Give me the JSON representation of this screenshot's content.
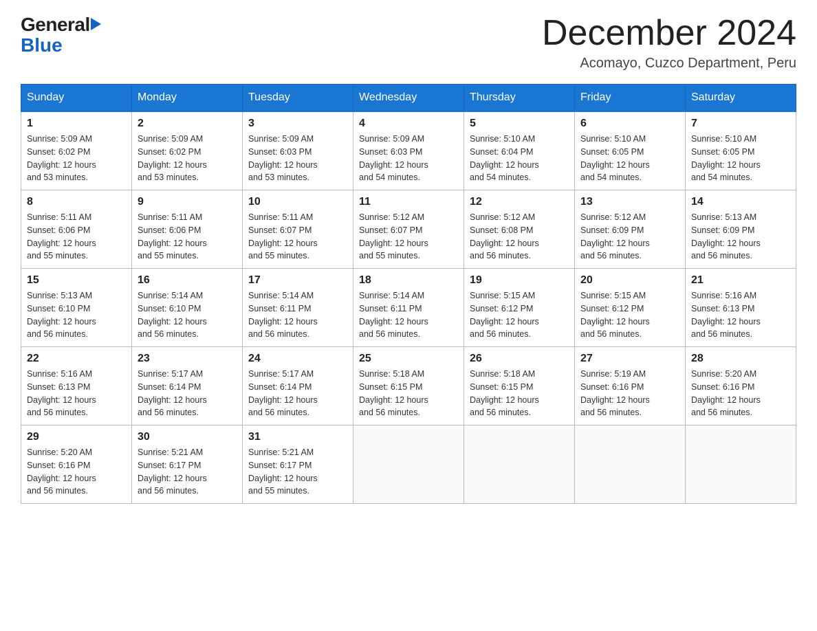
{
  "header": {
    "logo_general": "General",
    "logo_blue": "Blue",
    "title": "December 2024",
    "location": "Acomayo, Cuzco Department, Peru"
  },
  "days_of_week": [
    "Sunday",
    "Monday",
    "Tuesday",
    "Wednesday",
    "Thursday",
    "Friday",
    "Saturday"
  ],
  "weeks": [
    [
      {
        "day": "1",
        "sunrise": "5:09 AM",
        "sunset": "6:02 PM",
        "daylight": "12 hours and 53 minutes."
      },
      {
        "day": "2",
        "sunrise": "5:09 AM",
        "sunset": "6:02 PM",
        "daylight": "12 hours and 53 minutes."
      },
      {
        "day": "3",
        "sunrise": "5:09 AM",
        "sunset": "6:03 PM",
        "daylight": "12 hours and 53 minutes."
      },
      {
        "day": "4",
        "sunrise": "5:09 AM",
        "sunset": "6:03 PM",
        "daylight": "12 hours and 54 minutes."
      },
      {
        "day": "5",
        "sunrise": "5:10 AM",
        "sunset": "6:04 PM",
        "daylight": "12 hours and 54 minutes."
      },
      {
        "day": "6",
        "sunrise": "5:10 AM",
        "sunset": "6:05 PM",
        "daylight": "12 hours and 54 minutes."
      },
      {
        "day": "7",
        "sunrise": "5:10 AM",
        "sunset": "6:05 PM",
        "daylight": "12 hours and 54 minutes."
      }
    ],
    [
      {
        "day": "8",
        "sunrise": "5:11 AM",
        "sunset": "6:06 PM",
        "daylight": "12 hours and 55 minutes."
      },
      {
        "day": "9",
        "sunrise": "5:11 AM",
        "sunset": "6:06 PM",
        "daylight": "12 hours and 55 minutes."
      },
      {
        "day": "10",
        "sunrise": "5:11 AM",
        "sunset": "6:07 PM",
        "daylight": "12 hours and 55 minutes."
      },
      {
        "day": "11",
        "sunrise": "5:12 AM",
        "sunset": "6:07 PM",
        "daylight": "12 hours and 55 minutes."
      },
      {
        "day": "12",
        "sunrise": "5:12 AM",
        "sunset": "6:08 PM",
        "daylight": "12 hours and 56 minutes."
      },
      {
        "day": "13",
        "sunrise": "5:12 AM",
        "sunset": "6:09 PM",
        "daylight": "12 hours and 56 minutes."
      },
      {
        "day": "14",
        "sunrise": "5:13 AM",
        "sunset": "6:09 PM",
        "daylight": "12 hours and 56 minutes."
      }
    ],
    [
      {
        "day": "15",
        "sunrise": "5:13 AM",
        "sunset": "6:10 PM",
        "daylight": "12 hours and 56 minutes."
      },
      {
        "day": "16",
        "sunrise": "5:14 AM",
        "sunset": "6:10 PM",
        "daylight": "12 hours and 56 minutes."
      },
      {
        "day": "17",
        "sunrise": "5:14 AM",
        "sunset": "6:11 PM",
        "daylight": "12 hours and 56 minutes."
      },
      {
        "day": "18",
        "sunrise": "5:14 AM",
        "sunset": "6:11 PM",
        "daylight": "12 hours and 56 minutes."
      },
      {
        "day": "19",
        "sunrise": "5:15 AM",
        "sunset": "6:12 PM",
        "daylight": "12 hours and 56 minutes."
      },
      {
        "day": "20",
        "sunrise": "5:15 AM",
        "sunset": "6:12 PM",
        "daylight": "12 hours and 56 minutes."
      },
      {
        "day": "21",
        "sunrise": "5:16 AM",
        "sunset": "6:13 PM",
        "daylight": "12 hours and 56 minutes."
      }
    ],
    [
      {
        "day": "22",
        "sunrise": "5:16 AM",
        "sunset": "6:13 PM",
        "daylight": "12 hours and 56 minutes."
      },
      {
        "day": "23",
        "sunrise": "5:17 AM",
        "sunset": "6:14 PM",
        "daylight": "12 hours and 56 minutes."
      },
      {
        "day": "24",
        "sunrise": "5:17 AM",
        "sunset": "6:14 PM",
        "daylight": "12 hours and 56 minutes."
      },
      {
        "day": "25",
        "sunrise": "5:18 AM",
        "sunset": "6:15 PM",
        "daylight": "12 hours and 56 minutes."
      },
      {
        "day": "26",
        "sunrise": "5:18 AM",
        "sunset": "6:15 PM",
        "daylight": "12 hours and 56 minutes."
      },
      {
        "day": "27",
        "sunrise": "5:19 AM",
        "sunset": "6:16 PM",
        "daylight": "12 hours and 56 minutes."
      },
      {
        "day": "28",
        "sunrise": "5:20 AM",
        "sunset": "6:16 PM",
        "daylight": "12 hours and 56 minutes."
      }
    ],
    [
      {
        "day": "29",
        "sunrise": "5:20 AM",
        "sunset": "6:16 PM",
        "daylight": "12 hours and 56 minutes."
      },
      {
        "day": "30",
        "sunrise": "5:21 AM",
        "sunset": "6:17 PM",
        "daylight": "12 hours and 56 minutes."
      },
      {
        "day": "31",
        "sunrise": "5:21 AM",
        "sunset": "6:17 PM",
        "daylight": "12 hours and 55 minutes."
      },
      null,
      null,
      null,
      null
    ]
  ],
  "labels": {
    "sunrise": "Sunrise:",
    "sunset": "Sunset:",
    "daylight": "Daylight:"
  }
}
